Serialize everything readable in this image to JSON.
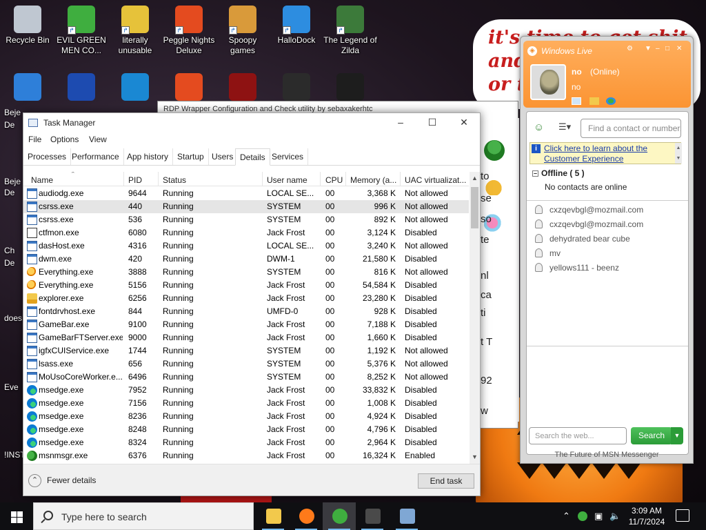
{
  "desktop": {
    "icons": [
      {
        "label": "Recycle Bin",
        "name": "recycle-bin-icon",
        "color": "#bfc7d1"
      },
      {
        "label": "EVIL GREEN MEN CO...",
        "name": "msn-people-icon",
        "color": "#3fae3f"
      },
      {
        "label": "literally unusable",
        "name": "chrome-icon",
        "color": "#e6c23a"
      },
      {
        "label": "Peggle Nights Deluxe",
        "name": "peggle-icon",
        "color": "#e44b1f"
      },
      {
        "label": "Spoopy games",
        "name": "folder-icon",
        "color": "#d99a3a"
      },
      {
        "label": "HalloDock",
        "name": "windows-logo-icon",
        "color": "#2d8de0"
      },
      {
        "label": "The Legend of Zilda",
        "name": "zelda-icon",
        "color": "#3c7a3a"
      }
    ],
    "left_fragments": [
      "Beje",
      "De",
      "Beje",
      "De",
      "Ch",
      "De",
      "does",
      "Eve",
      "!INST"
    ],
    "wallpaper_text": "it's time to get shit\nand\nor t"
  },
  "bg_window": {
    "title": "RDP Wrapper Configuration and Check utility by sebaxakerhtc",
    "fragments": [
      "to",
      "se",
      "so",
      "te",
      "nl",
      "ca",
      "ti",
      "t T",
      "92",
      "w"
    ]
  },
  "task_manager": {
    "title": "Task Manager",
    "menu": [
      "File",
      "Options",
      "View"
    ],
    "tabs": [
      "Processes",
      "Performance",
      "App history",
      "Startup",
      "Users",
      "Details",
      "Services"
    ],
    "active_tab": "Details",
    "columns": [
      "Name",
      "PID",
      "Status",
      "User name",
      "CPU",
      "Memory (a...",
      "UAC virtualizat..."
    ],
    "rows": [
      {
        "icon": "win",
        "name": "audiodg.exe",
        "pid": "9644",
        "status": "Running",
        "user": "LOCAL SE...",
        "cpu": "00",
        "mem": "3,368 K",
        "uac": "Not allowed"
      },
      {
        "icon": "win",
        "name": "csrss.exe",
        "pid": "440",
        "status": "Running",
        "user": "SYSTEM",
        "cpu": "00",
        "mem": "996 K",
        "uac": "Not allowed"
      },
      {
        "icon": "win",
        "name": "csrss.exe",
        "pid": "536",
        "status": "Running",
        "user": "SYSTEM",
        "cpu": "00",
        "mem": "892 K",
        "uac": "Not allowed"
      },
      {
        "icon": "pen",
        "name": "ctfmon.exe",
        "pid": "6080",
        "status": "Running",
        "user": "Jack Frost",
        "cpu": "00",
        "mem": "3,124 K",
        "uac": "Disabled"
      },
      {
        "icon": "win",
        "name": "dasHost.exe",
        "pid": "4316",
        "status": "Running",
        "user": "LOCAL SE...",
        "cpu": "00",
        "mem": "3,240 K",
        "uac": "Not allowed"
      },
      {
        "icon": "win",
        "name": "dwm.exe",
        "pid": "420",
        "status": "Running",
        "user": "DWM-1",
        "cpu": "00",
        "mem": "21,580 K",
        "uac": "Disabled"
      },
      {
        "icon": "key",
        "name": "Everything.exe",
        "pid": "3888",
        "status": "Running",
        "user": "SYSTEM",
        "cpu": "00",
        "mem": "816 K",
        "uac": "Not allowed"
      },
      {
        "icon": "key",
        "name": "Everything.exe",
        "pid": "5156",
        "status": "Running",
        "user": "Jack Frost",
        "cpu": "00",
        "mem": "54,584 K",
        "uac": "Disabled"
      },
      {
        "icon": "fold",
        "name": "explorer.exe",
        "pid": "6256",
        "status": "Running",
        "user": "Jack Frost",
        "cpu": "00",
        "mem": "23,280 K",
        "uac": "Disabled"
      },
      {
        "icon": "win",
        "name": "fontdrvhost.exe",
        "pid": "844",
        "status": "Running",
        "user": "UMFD-0",
        "cpu": "00",
        "mem": "928 K",
        "uac": "Disabled"
      },
      {
        "icon": "win",
        "name": "GameBar.exe",
        "pid": "9100",
        "status": "Running",
        "user": "Jack Frost",
        "cpu": "00",
        "mem": "7,188 K",
        "uac": "Disabled"
      },
      {
        "icon": "win",
        "name": "GameBarFTServer.exe",
        "pid": "9000",
        "status": "Running",
        "user": "Jack Frost",
        "cpu": "00",
        "mem": "1,660 K",
        "uac": "Disabled"
      },
      {
        "icon": "win",
        "name": "igfxCUIService.exe",
        "pid": "1744",
        "status": "Running",
        "user": "SYSTEM",
        "cpu": "00",
        "mem": "1,192 K",
        "uac": "Not allowed"
      },
      {
        "icon": "win",
        "name": "lsass.exe",
        "pid": "656",
        "status": "Running",
        "user": "SYSTEM",
        "cpu": "00",
        "mem": "5,376 K",
        "uac": "Not allowed"
      },
      {
        "icon": "win",
        "name": "MoUsoCoreWorker.e...",
        "pid": "6496",
        "status": "Running",
        "user": "SYSTEM",
        "cpu": "00",
        "mem": "8,252 K",
        "uac": "Not allowed"
      },
      {
        "icon": "edge",
        "name": "msedge.exe",
        "pid": "7952",
        "status": "Running",
        "user": "Jack Frost",
        "cpu": "00",
        "mem": "33,832 K",
        "uac": "Disabled"
      },
      {
        "icon": "edge",
        "name": "msedge.exe",
        "pid": "7156",
        "status": "Running",
        "user": "Jack Frost",
        "cpu": "00",
        "mem": "1,008 K",
        "uac": "Disabled"
      },
      {
        "icon": "edge",
        "name": "msedge.exe",
        "pid": "8236",
        "status": "Running",
        "user": "Jack Frost",
        "cpu": "00",
        "mem": "4,924 K",
        "uac": "Disabled"
      },
      {
        "icon": "edge",
        "name": "msedge.exe",
        "pid": "8248",
        "status": "Running",
        "user": "Jack Frost",
        "cpu": "00",
        "mem": "4,796 K",
        "uac": "Disabled"
      },
      {
        "icon": "edge",
        "name": "msedge.exe",
        "pid": "8324",
        "status": "Running",
        "user": "Jack Frost",
        "cpu": "00",
        "mem": "2,964 K",
        "uac": "Disabled"
      },
      {
        "icon": "msn",
        "name": "msnmsgr.exe",
        "pid": "6376",
        "status": "Running",
        "user": "Jack Frost",
        "cpu": "00",
        "mem": "16,324 K",
        "uac": "Enabled"
      }
    ],
    "selected_row": 1,
    "fewer_details": "Fewer details",
    "end_task": "End task"
  },
  "msn": {
    "title": "Windows Live",
    "username": "no",
    "status": "(Online)",
    "personal_message": "no",
    "find_placeholder": "Find a contact or number...",
    "banner": "Click here to learn about the Customer Experience",
    "group": "Offline ( 5 )",
    "no_contacts": "No contacts are online",
    "contacts": [
      "cxzqevbgl@mozmail.com",
      "cxzqevbgl@mozmail.com",
      "dehydrated bear cube",
      "mv",
      "yellows111 - beenz"
    ],
    "search_placeholder": "Search the web...",
    "search_button": "Search",
    "footer": "The Future of MSN Messenger",
    "accent": "#fb9433"
  },
  "taskbar": {
    "search_placeholder": "Type here to search",
    "apps": [
      {
        "name": "file-explorer-icon",
        "color": "#f2c94c",
        "active": false
      },
      {
        "name": "firefox-icon",
        "color": "#ff7a1a",
        "active": false
      },
      {
        "name": "msn-messenger-icon",
        "color": "#3fae3f",
        "active": true
      },
      {
        "name": "terminal-icon",
        "color": "#4a4a4a",
        "active": false
      },
      {
        "name": "task-manager-icon",
        "color": "#7fa7d4",
        "active": false
      }
    ],
    "time": "3:09 AM",
    "date": "11/7/2024"
  }
}
